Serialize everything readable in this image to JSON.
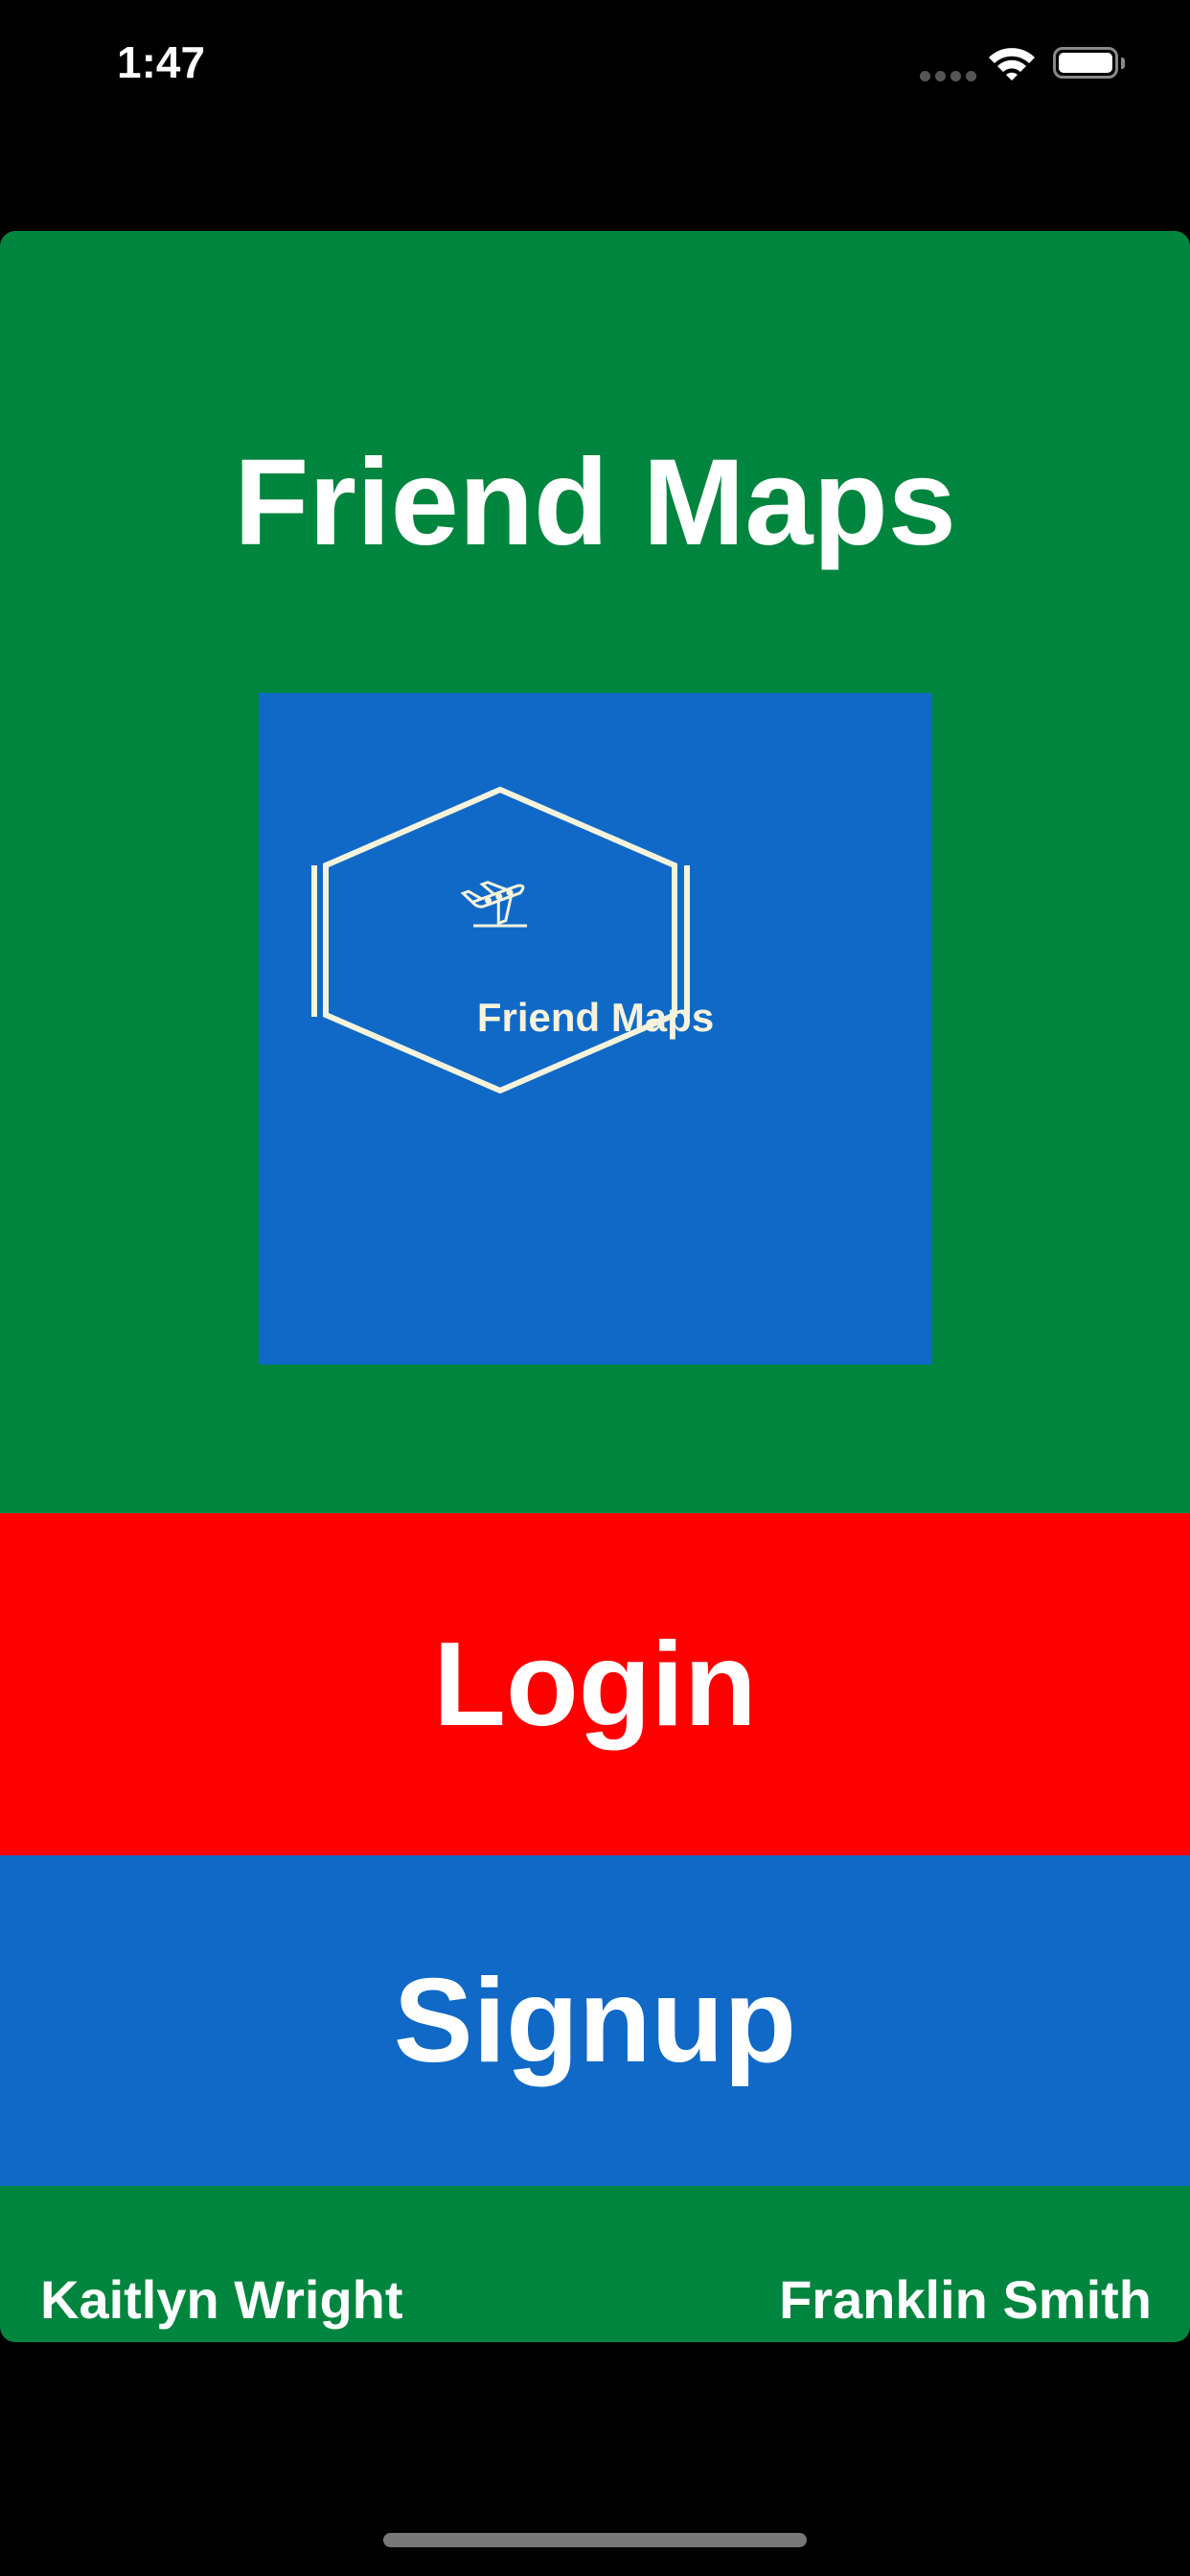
{
  "status_bar": {
    "time": "1:47"
  },
  "app": {
    "title": "Friend Maps"
  },
  "logo": {
    "text": "Friend Maps",
    "icon": "airplane-icon",
    "background": "#1069c6",
    "line_color": "#f6f3dc"
  },
  "buttons": {
    "login": "Login",
    "signup": "Signup"
  },
  "footer": {
    "left_name": "Kaitlyn Wright",
    "right_name": "Franklin Smith"
  },
  "colors": {
    "card": "#00853e",
    "login": "#ff0000",
    "signup": "#1069c6"
  }
}
